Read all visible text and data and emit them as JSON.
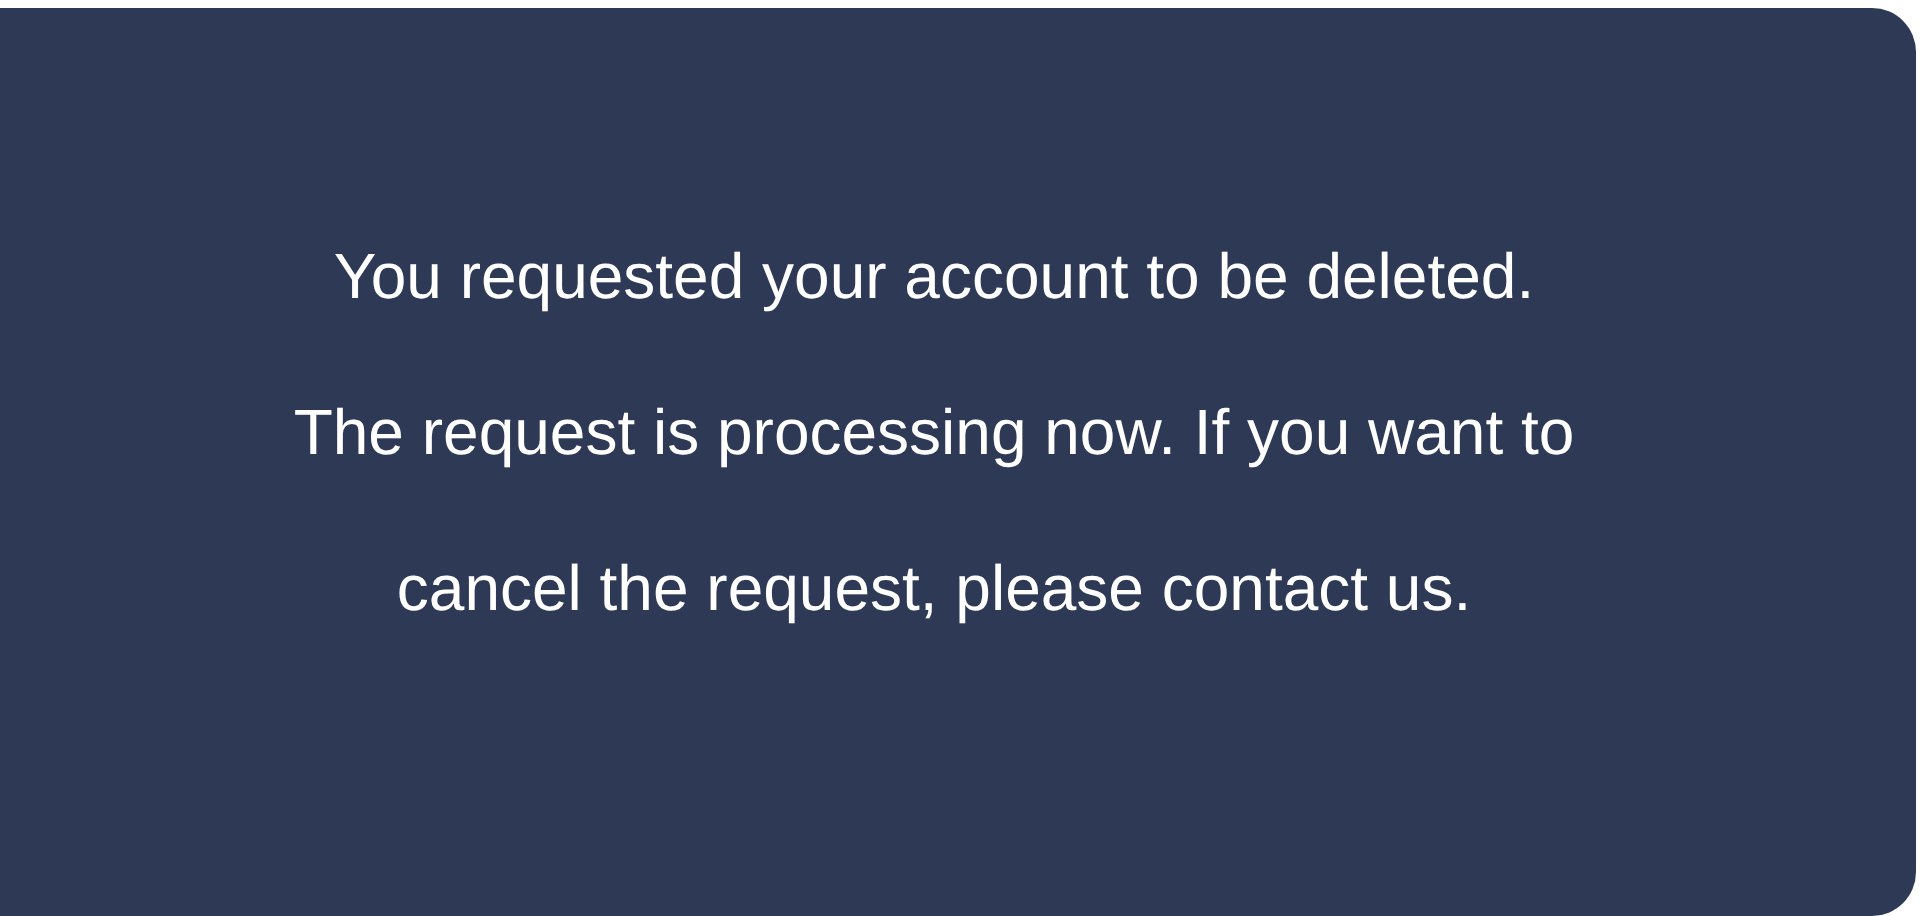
{
  "message": {
    "lines": [
      "You requested your account to be deleted.",
      "The request is processing now. If you want to",
      "cancel the request, please contact us."
    ]
  }
}
